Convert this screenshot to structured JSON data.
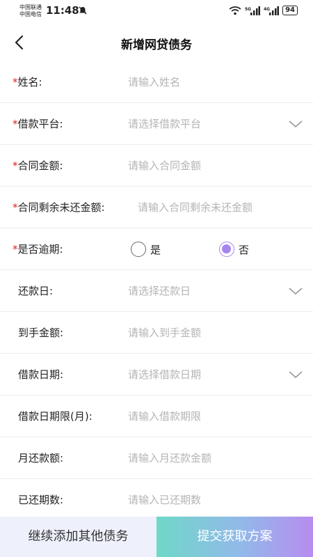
{
  "status_bar": {
    "carrier_1": "中国联通",
    "carrier_2": "中国电信",
    "time": "11:48",
    "battery": "94",
    "network_1": "5G",
    "network_2": "4G"
  },
  "header": {
    "title": "新增网贷债务"
  },
  "required_mark": "*",
  "form": {
    "name": {
      "label": "姓名:",
      "placeholder": "请输入姓名"
    },
    "platform": {
      "label": "借款平台:",
      "placeholder": "请选择借款平台"
    },
    "contract_amount": {
      "label": "合同金额:",
      "placeholder": "请输入合同金额"
    },
    "remaining_amount": {
      "label": "合同剩余未还金额:",
      "placeholder": "请输入合同剩余未还金额"
    },
    "overdue": {
      "label": "是否逾期:",
      "option_yes": "是",
      "option_no": "否",
      "selected": "否"
    },
    "repay_day": {
      "label": "还款日:",
      "placeholder": "请选择还款日"
    },
    "received_amount": {
      "label": "到手金额:",
      "placeholder": "请输入到手金额"
    },
    "loan_date": {
      "label": "借款日期:",
      "placeholder": "请选择借款日期"
    },
    "loan_term": {
      "label": "借款日期限(月):",
      "placeholder": "请输入借款期限"
    },
    "monthly_payment": {
      "label": "月还款额:",
      "placeholder": "请输入月还款金额"
    },
    "paid_periods": {
      "label": "已还期数:",
      "placeholder": "请输入已还期数"
    }
  },
  "footer": {
    "add_more_label": "继续添加其他债务",
    "submit_label": "提交获取方案"
  },
  "colors": {
    "accent": "#a685f0",
    "required": "#e02020",
    "placeholder": "#b4b4b4",
    "submit_gradient_start": "#6fd8c8",
    "submit_gradient_end": "#b78cf0",
    "secondary_button_bg": "#eef1fb"
  }
}
